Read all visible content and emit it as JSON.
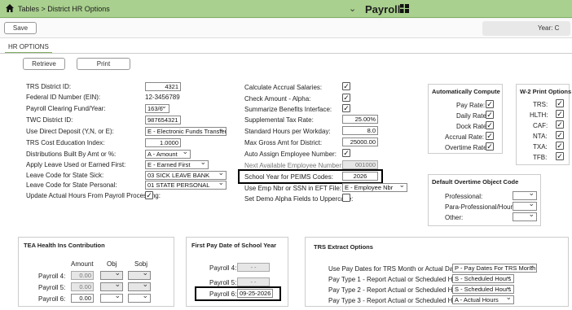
{
  "header": {
    "breadcrumb": "Tables > District HR Options",
    "module": "Payroll"
  },
  "toolbar": {
    "save": "Save",
    "year": "Year: C"
  },
  "tab": "HR OPTIONS",
  "actions": {
    "retrieve": "Retrieve",
    "print": "Print"
  },
  "left": {
    "district_id": {
      "label": "TRS District ID:",
      "value": "4321"
    },
    "ein": {
      "label": "Federal ID Number (EIN):",
      "value": "12-3456789"
    },
    "clearing_fund": {
      "label": "Payroll Clearing Fund/Year:",
      "value": "163/6"
    },
    "twc_id": {
      "label": "TWC District ID:",
      "value": "987654321"
    },
    "direct_deposit": {
      "label": "Use Direct Deposit (Y,N, or E):",
      "value": "E - Electronic Funds Transfer"
    },
    "trs_cost": {
      "label": "TRS Cost Education Index:",
      "value": "1.0000"
    },
    "distributions": {
      "label": "Distributions Built By Amt or %:",
      "value": "A - Amount"
    },
    "apply_leave": {
      "label": "Apply Leave Used or Earned First:",
      "value": "E - Earned First"
    },
    "leave_sick": {
      "label": "Leave Code for State Sick:",
      "value": "03 SICK LEAVE BANK"
    },
    "leave_personal": {
      "label": "Leave Code for State Personal:",
      "value": "01 STATE PERSONAL"
    },
    "update_actual": {
      "label": "Update Actual Hours From Payroll Processing:",
      "value": "✓"
    }
  },
  "middle": {
    "calc_accrual": {
      "label": "Calculate Accrual Salaries:",
      "value": "✓"
    },
    "check_amount": {
      "label": "Check Amount - Alpha:",
      "value": "✓"
    },
    "summarize": {
      "label": "Summarize Benefits Interface:",
      "value": "✓"
    },
    "supp_tax": {
      "label": "Supplemental Tax Rate:",
      "value": "25.00%"
    },
    "std_hours": {
      "label": "Standard Hours per Workday:",
      "value": "8.0"
    },
    "max_gross": {
      "label": "Max Gross Amt for District:",
      "value": "25000.00"
    },
    "auto_assign": {
      "label": "Auto Assign Employee Number:",
      "value": "✓"
    },
    "next_emp": {
      "label": "Next Available Employee Number:",
      "value": "001000"
    },
    "school_year": {
      "label": "School Year for PEIMS Codes:",
      "value": "2026"
    },
    "use_emp_nbr": {
      "label": "Use Emp Nbr or SSN in EFT File:",
      "value": "E - Employee Nbr"
    },
    "set_demo": {
      "label": "Set Demo Alpha Fields to Uppercase:",
      "value": ""
    }
  },
  "auto_compute": {
    "title": "Automatically Compute",
    "items": [
      {
        "label": "Pay Rate:",
        "value": "✓"
      },
      {
        "label": "Daily Rate:",
        "value": "✓"
      },
      {
        "label": "Dock Rate:",
        "value": "✓"
      },
      {
        "label": "Accrual Rate:",
        "value": "✓"
      },
      {
        "label": "Overtime Rate:",
        "value": "✓"
      }
    ]
  },
  "w2": {
    "title": "W-2 Print Options",
    "items": [
      {
        "label": "TRS:",
        "value": "✓"
      },
      {
        "label": "HLTH:",
        "value": "✓"
      },
      {
        "label": "CAF:",
        "value": "✓"
      },
      {
        "label": "NTA:",
        "value": "✓"
      },
      {
        "label": "TXA:",
        "value": "✓"
      },
      {
        "label": "TFB:",
        "value": "✓"
      }
    ]
  },
  "overtime": {
    "title": "Default Overtime Object Code",
    "professional": "Professional:",
    "para": "Para-Professional/Hourly:",
    "other": "Other:"
  },
  "tea": {
    "title": "TEA Health Ins Contribution",
    "headers": {
      "amount": "Amount",
      "obj": "Obj",
      "sobj": "Sobj"
    },
    "rows": [
      {
        "label": "Payroll 4:",
        "amount": "0.00"
      },
      {
        "label": "Payroll 5:",
        "amount": "0.00"
      },
      {
        "label": "Payroll 6:",
        "amount": "0.00"
      }
    ]
  },
  "first_pay": {
    "title": "First Pay Date of School Year",
    "rows": [
      {
        "label": "Payroll 4:",
        "value": "- -"
      },
      {
        "label": "Payroll 5:",
        "value": "- -"
      },
      {
        "label": "Payroll 6:",
        "value": "09-25-2026"
      }
    ]
  },
  "trs": {
    "title": "TRS Extract Options",
    "rows": [
      {
        "label": "Use Pay Dates for TRS Month or Actual Date:",
        "value": "P - Pay Dates For TRS Month"
      },
      {
        "label": "Pay Type 1 - Report Actual or Scheduled Hours:",
        "value": "S - Scheduled Hours"
      },
      {
        "label": "Pay Type 2 - Report Actual or Scheduled Hours:",
        "value": "S - Scheduled Hours"
      },
      {
        "label": "Pay Type 3 - Report Actual or Scheduled Hours:",
        "value": "A - Actual Hours"
      }
    ]
  }
}
